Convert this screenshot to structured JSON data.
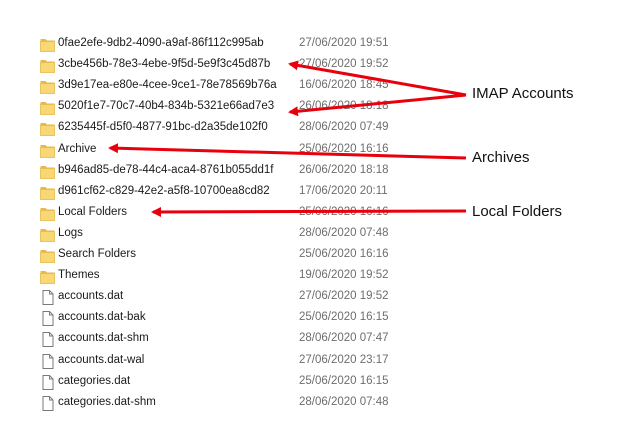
{
  "files": [
    {
      "name": "0fae2efe-9db2-4090-a9af-86f112c995ab",
      "date": "27/06/2020 19:51",
      "type": "folder"
    },
    {
      "name": "3cbe456b-78e3-4ebe-9f5d-5e9f3c45d87b",
      "date": "27/06/2020 19:52",
      "type": "folder"
    },
    {
      "name": "3d9e17ea-e80e-4cee-9ce1-78e78569b76a",
      "date": "16/06/2020 18:45",
      "type": "folder"
    },
    {
      "name": "5020f1e7-70c7-40b4-834b-5321e66ad7e3",
      "date": "26/06/2020 18:18",
      "type": "folder"
    },
    {
      "name": "6235445f-d5f0-4877-91bc-d2a35de102f0",
      "date": "28/06/2020 07:49",
      "type": "folder"
    },
    {
      "name": "Archive",
      "date": "25/06/2020 16:16",
      "type": "folder"
    },
    {
      "name": "b946ad85-de78-44c4-aca4-8761b055dd1f",
      "date": "26/06/2020 18:18",
      "type": "folder"
    },
    {
      "name": "d961cf62-c829-42e2-a5f8-10700ea8cd82",
      "date": "17/06/2020 20:11",
      "type": "folder"
    },
    {
      "name": "Local Folders",
      "date": "25/06/2020 16:16",
      "type": "folder"
    },
    {
      "name": "Logs",
      "date": "28/06/2020 07:48",
      "type": "folder"
    },
    {
      "name": "Search Folders",
      "date": "25/06/2020 16:16",
      "type": "folder"
    },
    {
      "name": "Themes",
      "date": "19/06/2020 19:52",
      "type": "folder"
    },
    {
      "name": "accounts.dat",
      "date": "27/06/2020 19:52",
      "type": "file"
    },
    {
      "name": "accounts.dat-bak",
      "date": "25/06/2020 16:15",
      "type": "file"
    },
    {
      "name": "accounts.dat-shm",
      "date": "28/06/2020 07:47",
      "type": "file"
    },
    {
      "name": "accounts.dat-wal",
      "date": "27/06/2020 23:17",
      "type": "file"
    },
    {
      "name": "categories.dat",
      "date": "25/06/2020 16:15",
      "type": "file"
    },
    {
      "name": "categories.dat-shm",
      "date": "28/06/2020 07:48",
      "type": "file"
    }
  ],
  "annotations": {
    "imap_label": "IMAP Accounts",
    "archives_label": "Archives",
    "local_label": "Local Folders"
  },
  "colors": {
    "folder_body": "#f8d775",
    "folder_tab": "#e6b94a",
    "arrow": "#e8000d",
    "date_text": "#6d6d6d"
  },
  "icons": {
    "folder": "folder-icon",
    "file": "file-icon"
  }
}
